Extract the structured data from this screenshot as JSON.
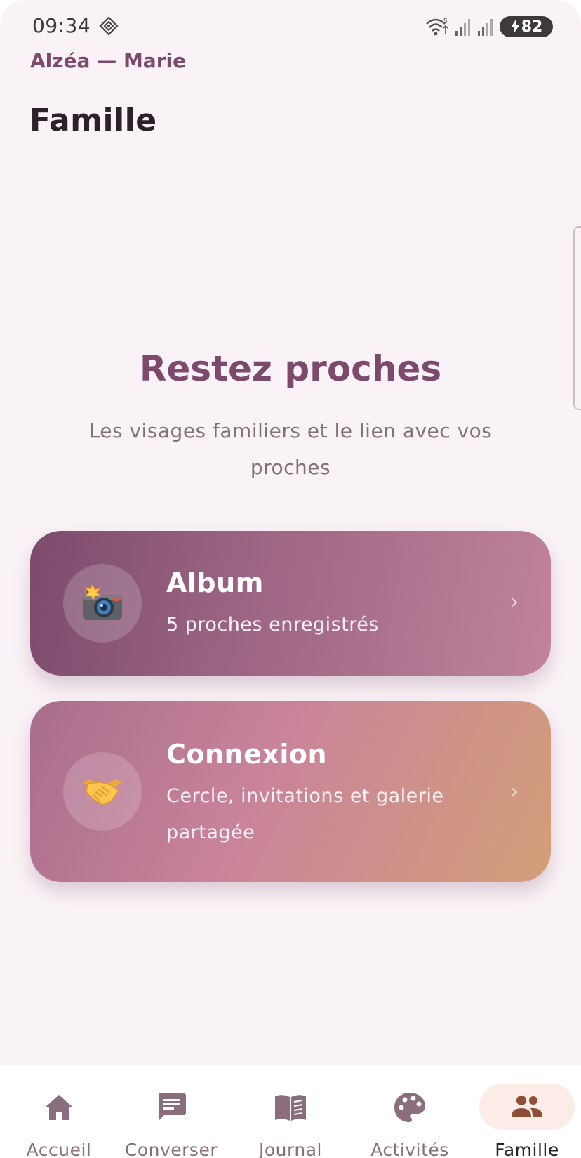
{
  "status_bar": {
    "time": "09:34",
    "battery_level": "82",
    "battery_charging": true,
    "wifi_badge": "5"
  },
  "header": {
    "app_user": "Alzéa — Marie",
    "title": "Famille"
  },
  "hero": {
    "title": "Restez proches",
    "subtitle": "Les visages familiers et le lien avec vos proches"
  },
  "cards": [
    {
      "title": "Album",
      "description": "5 proches enregistrés",
      "icon": "camera-with-flash-icon",
      "chevron": "›"
    },
    {
      "title": "Connexion",
      "description": "Cercle, invitations et galerie partagée",
      "icon": "handshake-icon",
      "chevron": "›"
    }
  ],
  "bottom_nav": {
    "items": [
      {
        "label": "Accueil",
        "icon": "home-icon"
      },
      {
        "label": "Converser",
        "icon": "chat-icon"
      },
      {
        "label": "Journal",
        "icon": "book-icon"
      },
      {
        "label": "Activités",
        "icon": "palette-icon"
      },
      {
        "label": "Famille",
        "icon": "people-icon",
        "active": true
      }
    ]
  },
  "colors": {
    "background": "#f9f2f6",
    "accent": "#7b4a6c",
    "nav_icon": "#8a6e7d",
    "active_pill": "#fbece8",
    "active_icon": "#8c4f36"
  }
}
